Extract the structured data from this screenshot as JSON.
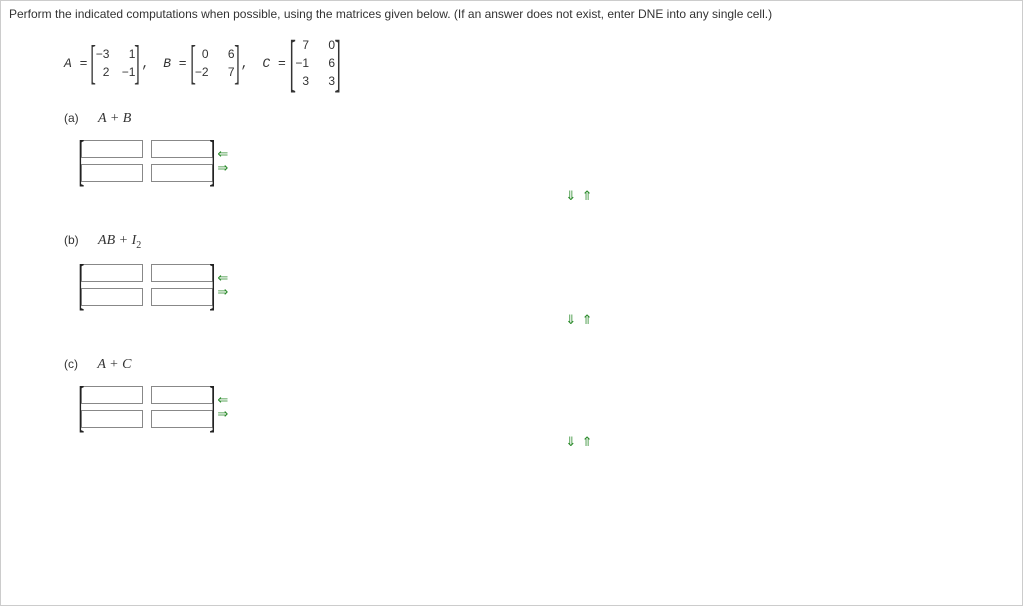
{
  "instructions": "Perform the indicated computations when possible, using the matrices given below. (If an answer does not exist, enter DNE into any single cell.)",
  "matrices": {
    "A": {
      "label": "A =",
      "rows": [
        [
          "−3",
          "1"
        ],
        [
          "2",
          "−1"
        ]
      ]
    },
    "B": {
      "label": "B =",
      "rows": [
        [
          "0",
          "6"
        ],
        [
          "−2",
          "7"
        ]
      ]
    },
    "C": {
      "label": "C =",
      "rows": [
        [
          "7",
          "0"
        ],
        [
          "−1",
          "6"
        ],
        [
          "3",
          "3"
        ]
      ]
    }
  },
  "separator": ",",
  "parts": {
    "a": {
      "label": "(a)",
      "expr_prefix": "A",
      "expr_mid": " + ",
      "expr_suffix": "B"
    },
    "b": {
      "label": "(b)",
      "expr_prefix": "AB",
      "expr_mid": " + ",
      "expr_suffix": "I",
      "sub": "2"
    },
    "c": {
      "label": "(c)",
      "expr_prefix": "A",
      "expr_mid": " + ",
      "expr_suffix": "C"
    }
  },
  "arrows": {
    "left": "⇐",
    "right": "⇒",
    "down": "⇓",
    "up": "⇑"
  }
}
